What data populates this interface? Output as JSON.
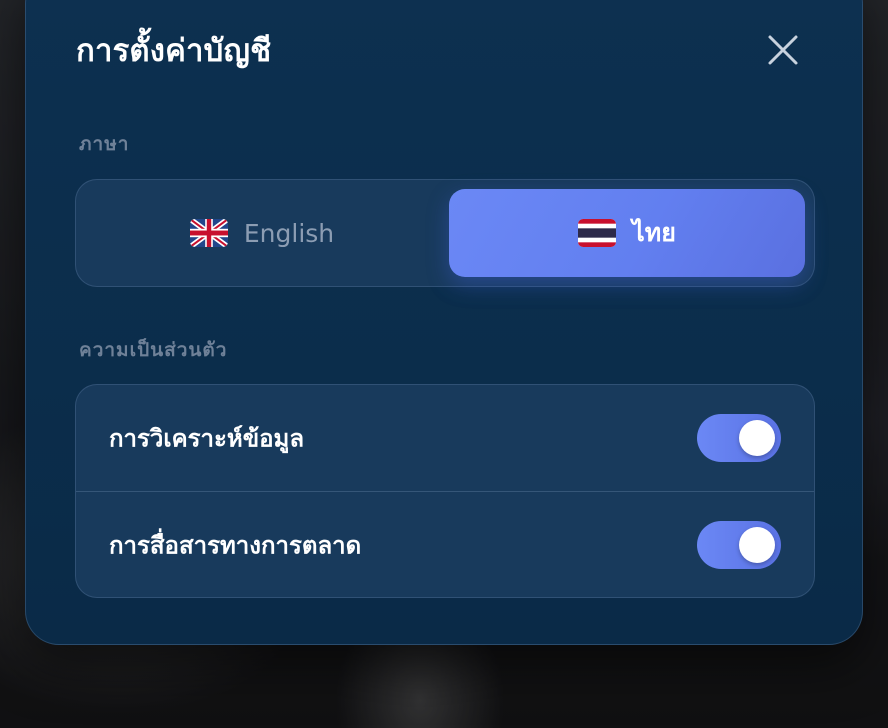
{
  "dialog": {
    "title": "การตั้งค่าบัญชี",
    "close_icon": "close-icon"
  },
  "language": {
    "section_label": "ภาษา",
    "options": [
      {
        "label": "English",
        "flag_icon": "uk-flag-icon",
        "selected": false
      },
      {
        "label": "ไทย",
        "flag_icon": "thai-flag-icon",
        "selected": true
      }
    ]
  },
  "privacy": {
    "section_label": "ความเป็นส่วนตัว",
    "items": [
      {
        "label": "การวิเคราะห์ข้อมูล",
        "enabled": true
      },
      {
        "label": "การสื่อสารทางการตลาด",
        "enabled": true
      }
    ]
  },
  "colors": {
    "accent": "#627ff0",
    "dialog_bg": "#0b2d4b",
    "card_bg": "#183a5c",
    "muted_text": "#6f8198"
  }
}
